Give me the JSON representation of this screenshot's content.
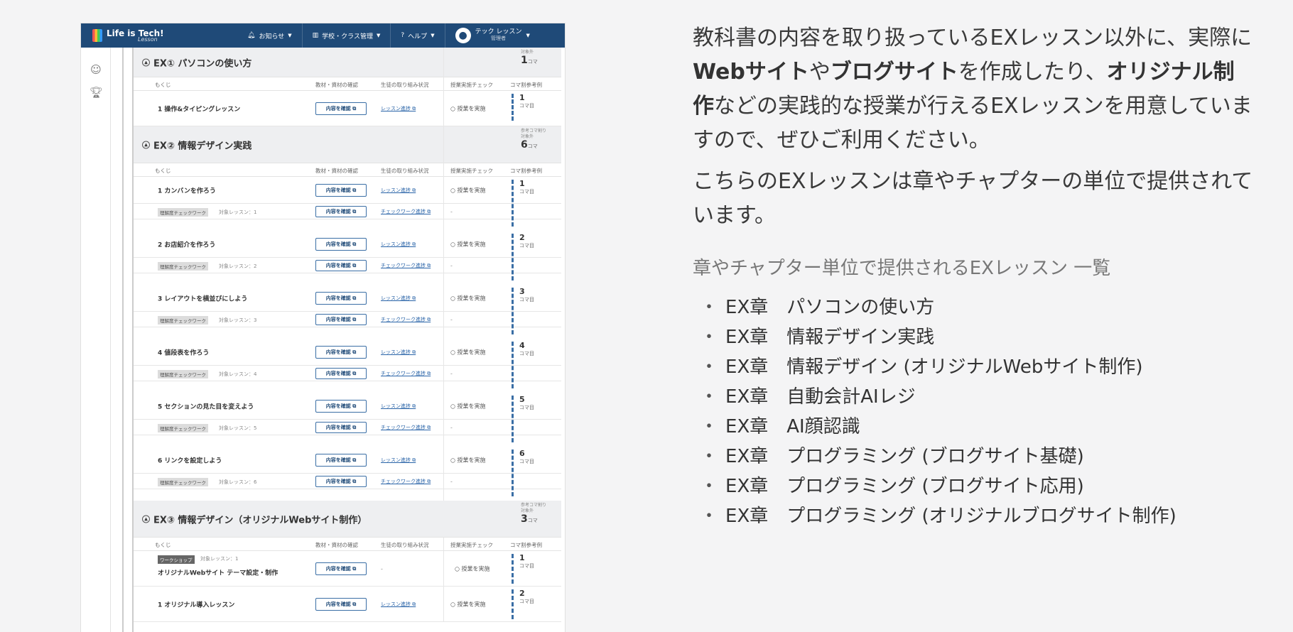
{
  "app": {
    "brand": "Life is Tech!",
    "brand_sub": "Lesson",
    "nav": [
      {
        "icon": "bell-icon",
        "label": "お知らせ"
      },
      {
        "icon": "school-icon",
        "label": "学校・クラス管理"
      },
      {
        "icon": "help-icon",
        "label": "ヘルプ"
      }
    ],
    "user": {
      "name": "テック レッスン",
      "role": "管理者"
    }
  },
  "columns": {
    "toc": "もくじ",
    "material": "教材・資材の確認",
    "progress": "生徒の取り組み状況",
    "check": "授業実施チェック",
    "koma": "コマ割参考例"
  },
  "common": {
    "content_btn": "内容を確認",
    "lesson_progress": "レッスン進捗",
    "checkwork_progress": "チェックワーク進捗",
    "do_class": "授業を実施",
    "dash": "-",
    "koma_unit": "コマ目",
    "quiz_tag": "理解度チェックワーク",
    "workshop_tag": "ワークショップ",
    "target_label": "対象レッスン："
  },
  "sections": [
    {
      "title": "EX① パソコンの使い方",
      "meta": "対象外",
      "count": "1",
      "count_unit": "コマ",
      "rows": [
        {
          "title": "1 操作&タイピングレッスン",
          "koma": "1"
        }
      ]
    },
    {
      "title": "EX② 情報デザイン実践",
      "meta1": "参考コマ割り",
      "meta2": "対象外",
      "count": "6",
      "count_unit": "コマ",
      "rows": [
        {
          "title": "1 カンバンを作ろう",
          "koma": "1",
          "target": "1"
        },
        {
          "title": "2 お店紹介を作ろう",
          "koma": "2",
          "target": "2"
        },
        {
          "title": "3 レイアウトを横並びにしよう",
          "koma": "3",
          "target": "3"
        },
        {
          "title": "4 値段表を作ろう",
          "koma": "4",
          "target": "4"
        },
        {
          "title": "5 セクションの見た目を変えよう",
          "koma": "5",
          "target": "5"
        },
        {
          "title": "6 リンクを設定しよう",
          "koma": "6",
          "target": "6"
        }
      ]
    },
    {
      "title": "EX③ 情報デザイン（オリジナルWebサイト制作）",
      "meta1": "参考コマ割り",
      "meta2": "対象外",
      "count": "3",
      "count_unit": "コマ",
      "rows": [
        {
          "title": "オリジナルWebサイト テーマ設定・制作",
          "koma": "1",
          "target": "1"
        },
        {
          "title": "1 オリジナル導入レッスン",
          "koma": "2"
        }
      ]
    }
  ],
  "explain": {
    "p1_a": "教科書の内容を取り扱っているEXレッスン以外に、実際に",
    "p1_b": "Webサイト",
    "p1_c": "や",
    "p1_d": "ブログサイト",
    "p1_e": "を作成したり、",
    "p1_f": "オリジナル制作",
    "p1_g": "などの実践的な授業が行えるEXレッスンを用意していますので、ぜひご利用ください。",
    "p2": "こちらのEXレッスンは章やチャプターの単位で提供されています。",
    "list_heading": "章やチャプター単位で提供されるEXレッスン 一覧",
    "list": [
      "EX章　パソコンの使い方",
      "EX章　情報デザイン実践",
      "EX章　情報デザイン (オリジナルWebサイト制作)",
      "EX章　自動会計AIレジ",
      "EX章　AI顔認識",
      "EX章　プログラミング (ブログサイト基礎)",
      "EX章　プログラミング (ブログサイト応用)",
      "EX章　プログラミング (オリジナルブログサイト制作)"
    ]
  }
}
